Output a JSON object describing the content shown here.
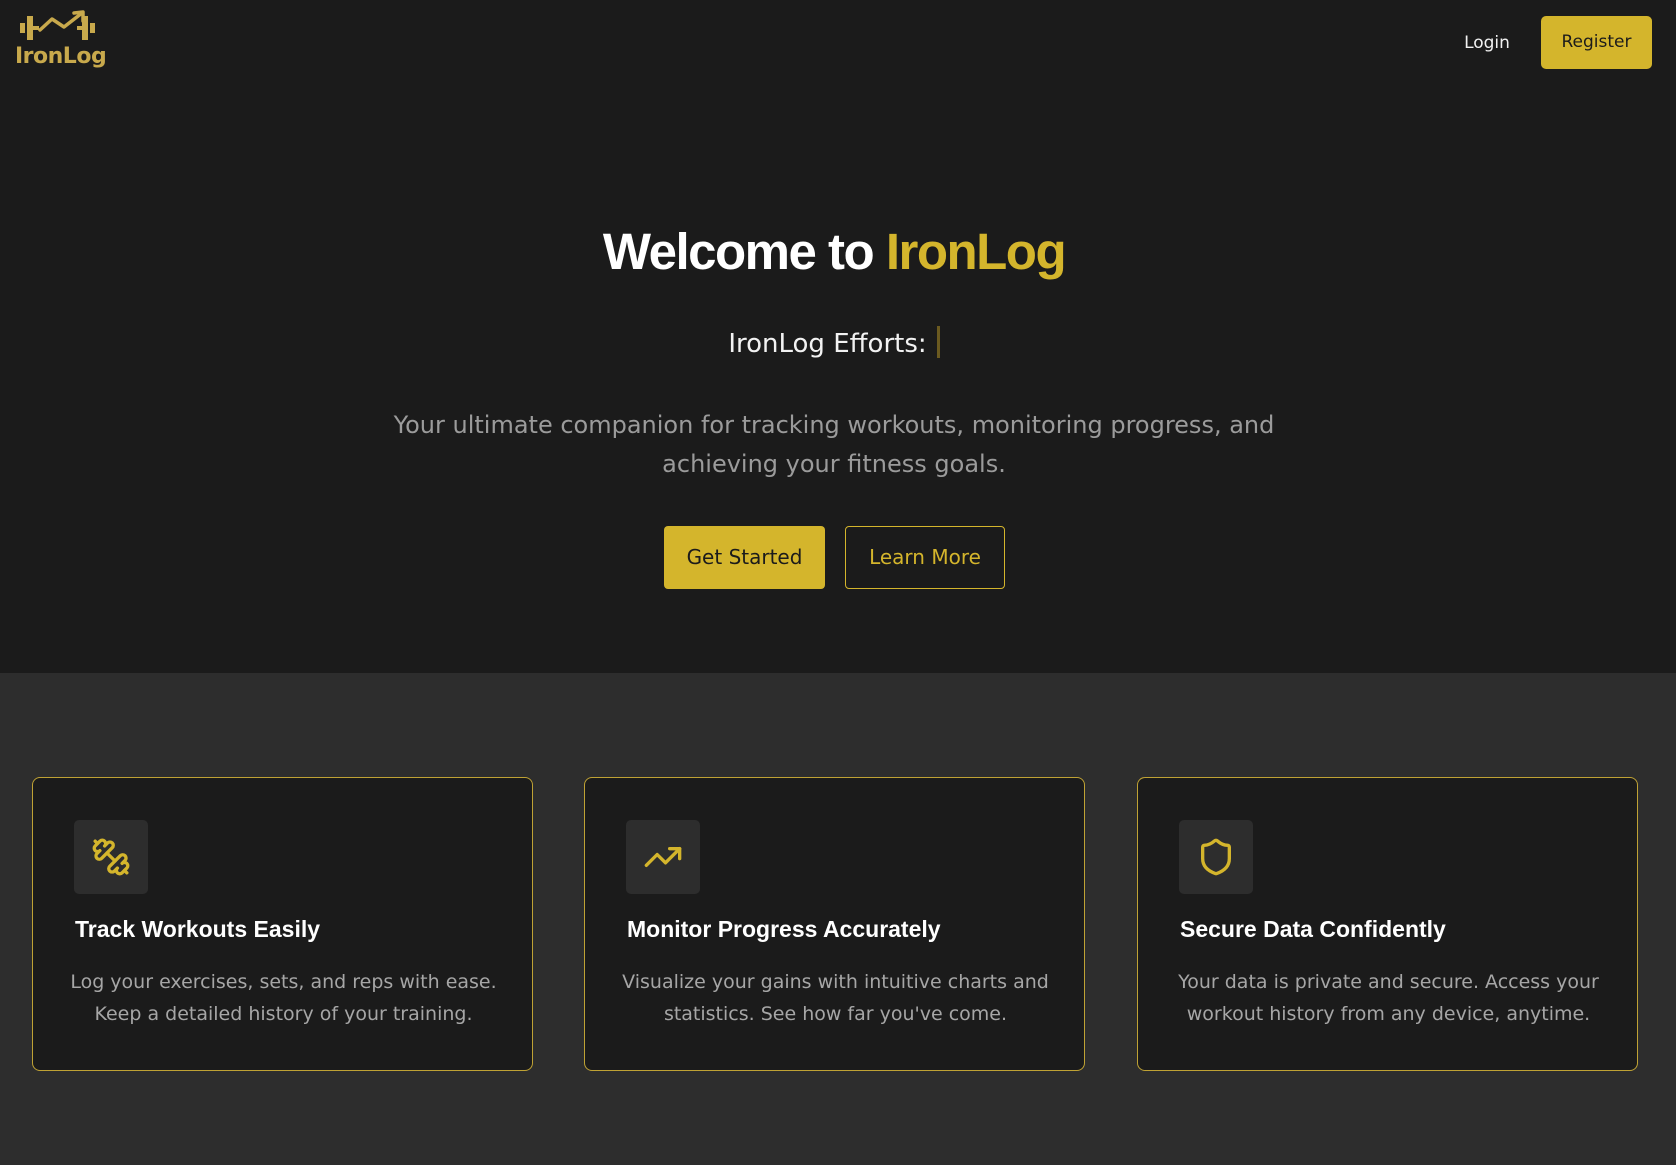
{
  "brand": {
    "name": "IronLog",
    "icon": "barbell-trend-icon",
    "color": "#c8a94c"
  },
  "nav": {
    "login_label": "Login",
    "register_label": "Register"
  },
  "hero": {
    "title_prefix": "Welcome to ",
    "title_highlight": "IronLog",
    "efforts_label": "IronLog Efforts:",
    "description": "Your ultimate companion for tracking workouts, monitoring progress, and achieving your fitness goals.",
    "primary_cta": "Get Started",
    "secondary_cta": "Learn More"
  },
  "features": [
    {
      "icon": "dumbbell-icon",
      "title": "Track Workouts Easily",
      "text": "Log your exercises, sets, and reps with ease. Keep a detailed history of your training."
    },
    {
      "icon": "trending-up-icon",
      "title": "Monitor Progress Accurately",
      "text": "Visualize your gains with intuitive charts and statistics. See how far you've come."
    },
    {
      "icon": "shield-icon",
      "title": "Secure Data Confidently",
      "text": "Your data is private and secure. Access your workout history from any device, anytime."
    }
  ],
  "colors": {
    "accent": "#d4b52c",
    "hero_background": "#1b1b1b",
    "section_background": "#2d2d2d",
    "card_border": "#bfa234",
    "muted_text": "#9b9b9b"
  }
}
